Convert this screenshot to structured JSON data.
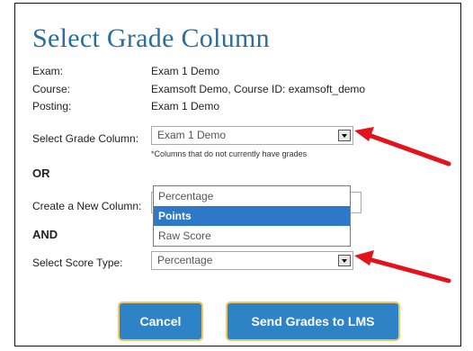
{
  "dialog": {
    "title": "Select Grade Column",
    "fields": {
      "exam_label": "Exam:",
      "exam_value": "Exam 1 Demo",
      "course_label": "Course:",
      "course_value": "Examsoft Demo, Course ID: examsoft_demo",
      "posting_label": "Posting:",
      "posting_value": "Exam 1 Demo"
    },
    "select_grade_column": {
      "label": "Select Grade Column:",
      "value": "Exam 1 Demo",
      "note": "*Columns that do not currently have grades"
    },
    "or_label": "OR",
    "create_new_column": {
      "label": "Create a New Column:"
    },
    "score_type_options": [
      "Percentage",
      "Points",
      "Raw Score"
    ],
    "highlighted_option": "Points",
    "and_label": "AND",
    "select_score_type": {
      "label": "Select Score Type:",
      "value": "Percentage"
    },
    "buttons": {
      "cancel": "Cancel",
      "send": "Send Grades to LMS"
    }
  },
  "colors": {
    "title": "#2a6ea0",
    "button": "#2e83c6",
    "button_border": "#f0c860",
    "highlight": "#2e78c8",
    "annotation_arrow": "#e3121b"
  }
}
